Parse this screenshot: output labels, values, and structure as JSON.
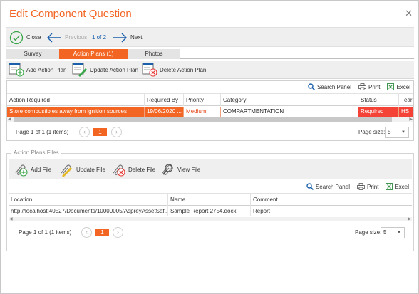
{
  "window": {
    "title": "Edit Component Question"
  },
  "nav": {
    "close": "Close",
    "previous": "Previous",
    "counter": "1 of 2",
    "next": "Next"
  },
  "tabs": [
    {
      "label": "Survey",
      "active": false
    },
    {
      "label": "Action Plans (1)",
      "active": true
    },
    {
      "label": "Photos",
      "active": false
    }
  ],
  "actions": {
    "add": "Add Action Plan",
    "update": "Update Action Plan",
    "delete": "Delete Action Plan"
  },
  "grid_tools": {
    "search": "Search Panel",
    "print": "Print",
    "excel": "Excel"
  },
  "action_grid": {
    "columns": [
      "Action Required",
      "Required By",
      "Priority",
      "Category",
      "Status",
      "Tear"
    ],
    "rows": [
      {
        "action": "Store combustibles away from ignition sources",
        "required_by": "19/06/2020 ...",
        "priority": "Medium",
        "category": "COMPARTMENTATION",
        "status": "Required",
        "team": "HS"
      }
    ],
    "pager": {
      "summary": "Page 1 of 1 (1 items)",
      "page": "1",
      "size_label": "Page size:",
      "size_value": "5"
    }
  },
  "files": {
    "legend": "Action Plans Files",
    "toolbar": {
      "add": "Add File",
      "update": "Update File",
      "delete": "Delete File",
      "view": "View File"
    },
    "columns": [
      "Location",
      "Name",
      "Comment"
    ],
    "rows": [
      {
        "location": "http://localhost:40527/Documents/10000005/AspreyAssetSaf...",
        "name": "Sample Report 2754.docx",
        "comment": "Report"
      }
    ],
    "pager": {
      "summary": "Page 1 of 1 (1 items)",
      "page": "1",
      "size_label": "Page size:",
      "size_value": "5"
    }
  },
  "colors": {
    "accent": "#f26522",
    "status_red": "#f44336",
    "link_blue": "#1a5faa"
  }
}
